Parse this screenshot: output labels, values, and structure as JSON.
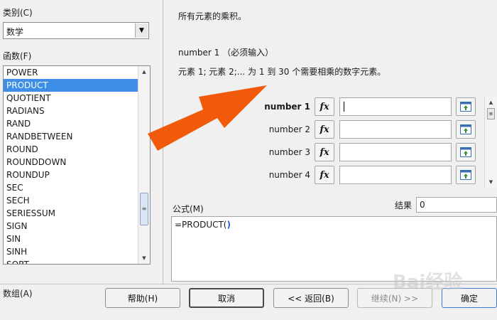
{
  "left": {
    "category_label": "类别(C)",
    "category_value": "数学",
    "functions_label": "函数(F)",
    "functions": [
      "POWER",
      "PRODUCT",
      "QUOTIENT",
      "RADIANS",
      "RAND",
      "RANDBETWEEN",
      "ROUND",
      "ROUNDDOWN",
      "ROUNDUP",
      "SEC",
      "SECH",
      "SERIESSUM",
      "SIGN",
      "SIN",
      "SINH",
      "SQRT"
    ],
    "selected_index": 1,
    "array_label": "数组(A)"
  },
  "right": {
    "description": "所有元素的乘积。",
    "arg_title": "number 1 （必须输入）",
    "arg_desc": "元素 1; 元素 2;... 为 1 到 30 个需要相乘的数字元素。",
    "args": [
      {
        "label": "number 1",
        "value": "",
        "bold": true
      },
      {
        "label": "number 2",
        "value": "",
        "bold": false
      },
      {
        "label": "number 3",
        "value": "",
        "bold": false
      },
      {
        "label": "number 4",
        "value": "",
        "bold": false
      }
    ],
    "fx_glyph": "fx",
    "formula_label": "公式(M)",
    "formula_prefix": "=PRODUCT(",
    "formula_cursor": ")",
    "result_label": "结果",
    "result_value": "0"
  },
  "buttons": {
    "help": "帮助(H)",
    "cancel": "取消",
    "back": "<< 返回(B)",
    "next": "继续(N) >>",
    "ok": "确定"
  },
  "watermark": "Bai经验",
  "colors": {
    "selection": "#3d8ee6",
    "arrow": "#f05a0a"
  }
}
